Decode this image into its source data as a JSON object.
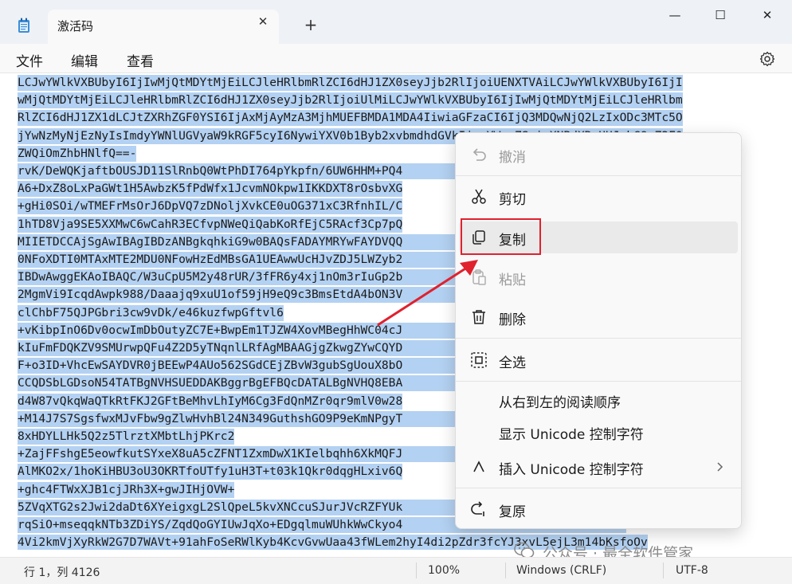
{
  "window": {
    "tab_title": "激活码",
    "tab_close": "✕",
    "new_tab": "+",
    "minimize": "—",
    "maximize": "☐",
    "close": "✕"
  },
  "menu": {
    "file": "文件",
    "edit": "编辑",
    "view": "查看"
  },
  "editor": {
    "lines": [
      "LCJwYWlkVXBUbyI6IjIwMjQtMDYtMjEiLCJleHRlbmRlZCI6dHJ1ZX0seyJjb2RlIjoiUENXTVAiLCJwYWlkVXBUbyI6IjI",
      "wMjQtMDYtMjEiLCJleHRlbmRlZCI6dHJ1ZX0seyJjb2RlIjoiUlMiLCJwYWlkVXBUbyI6IjIwMjQtMDYtMjEiLCJleHRlbm",
      "RlZCI6dHJ1ZX1dLCJtZXRhZGF0YSI6IjAxMjAyMzA3MjhMUEFBMDA1MDA4IiwiaGFzaCI6IjQ3MDQwNjQ2LzIxODc3MTc5O",
      "jYwNzMyNjEzNyIsImdyYWNlUGVyaW9kRGF5cyI6NywiYXV0b1Byb2xvbmdhdGVkIjpmYWxzZSwiaXNBdXRvUHJvbG9uZ2F0",
      "ZWQiOmZhbHNlfQ==-",
      "rvK/DeWQKjaftbOUSJD11SlRnbQ0WtPhDI764pYkpfn/6UW6HHM+PQ4                            J2aY",
      "A6+DxZ8oLxPaGWt1H5AwbzK5fPdWfx1JcvmNOkpw1IKKDXT8rOsbvXG",
      "+gHi0SOi/wTMEFrMsOrJ6DpVQ7zDNoljXvkCE0uOG371xC3RfnhIL/C",
      "1hTD8Vja9SE5XXMwC6wCahR3ECfvpNWeQiQabKoRfEjC5RAcf3Cp7pQ",
      "MIIETDCCAjSgAwIBAgIBDzANBgkqhkiG9w0BAQsFADAYMRYwFAYDVQQ                            2MDU",
      "0NFoXDTI0MTAxMTE2MDU0NFowHzEdMBsGA1UEAwwUcHJvZDJ5LWZyb2                            UAA4",
      "IBDwAwggEKAoIBAQC/W3uCpU5M2y48rUR/3fFR6y4xj1nOm3rIuGp2b                            yiDs",
      "2MgmVi9IcqdAwpk988/Daaajq9xuU1of59jH9eQ9c3BmsEtdA4bON3V                            oQZc",
      "clChbF75QJPGbri3cw9vDk/e46kuzfwpGftvl6",
      "+vKibpInO6Dv0ocwImDbOutyZC7E+BwpEm1TJZW4XovMBegHhWC04cJ                            63Rc",
      "kIuFmFDQKZV9SMUrwpQFu4Z2D5yTNqnlLRfAgMBAAGjgZkwgZYwCQYD                            nIeZ",
      "F+o3ID+VhcEwSAYDVR0jBEEwP4AUo562SGdCEjZBvW3gubSgUouX8bO                            gQ0G",
      "CCQDSbLGDsoN54TATBgNVHSUEDDAKBggrBgEFBQcDATALBgNVHQ8EBA                            nEKi",
      "d4W87vQkqWaQTkRtFKJ2GFtBeMhvLhIyM6Cg3FdQnMZr0qr9mlV0w28",
      "+M14J7S7SgsfwxMJvFbw9gZlwHvhBl24N349GuthshGO9P9eKmNPgyT                            JDrg",
      "8xHDYLLHk5Q2z5TlrztXMbtLhjPKrc2",
      "+ZajFFshgE5eowfkutSYxeX8uA5cZFNT1ZxmDwX1KIelbqhh6XkMQFJ                            AB11",
      "AlMKO2x/1hoKiHBU3oU3OKRTfoUTfy1uH3T+t03k1Qkr0dqgHLxiv6Q",
      "+ghc4FTWxXJB1cjJRh3X+gwJIHjOVW+",
      "5ZVqXTG2s2Jwi2daDt6XYeigxgL2SlQpeL5kvXNCcuSJurJVcRZFYUk                            Jd2T",
      "rqSiO+mseqqkNTb3ZDiYS/ZqdQoGYIUwJqXo+EDgqlmuWUhkWwCkyo4                            O1hk",
      "4Vi2kmVjXyRkW2G7D7WAVt+91ahFoSeRWlKyb4KcvGvwUaa43fWLem2hyI4di2pZdr3fcYJ3xvL5ejL3m14bKsfoOv"
    ]
  },
  "context_menu": {
    "undo": "撤消",
    "cut": "剪切",
    "copy": "复制",
    "paste": "粘贴",
    "delete": "删除",
    "select_all": "全选",
    "rtl": "从右到左的阅读顺序",
    "show_unicode": "显示 Unicode 控制字符",
    "insert_unicode": "插入 Unicode 控制字符",
    "reconvert": "复原"
  },
  "status": {
    "position": "行 1，列 4126",
    "zoom": "100%",
    "line_ending": "Windows (CRLF)",
    "encoding": "UTF-8"
  },
  "watermark": {
    "text": "公众号 · 最全软件管家"
  },
  "colors": {
    "selection": "#b3d1f2",
    "highlight_box": "#e0212e",
    "titlebar": "#eef1f6"
  }
}
